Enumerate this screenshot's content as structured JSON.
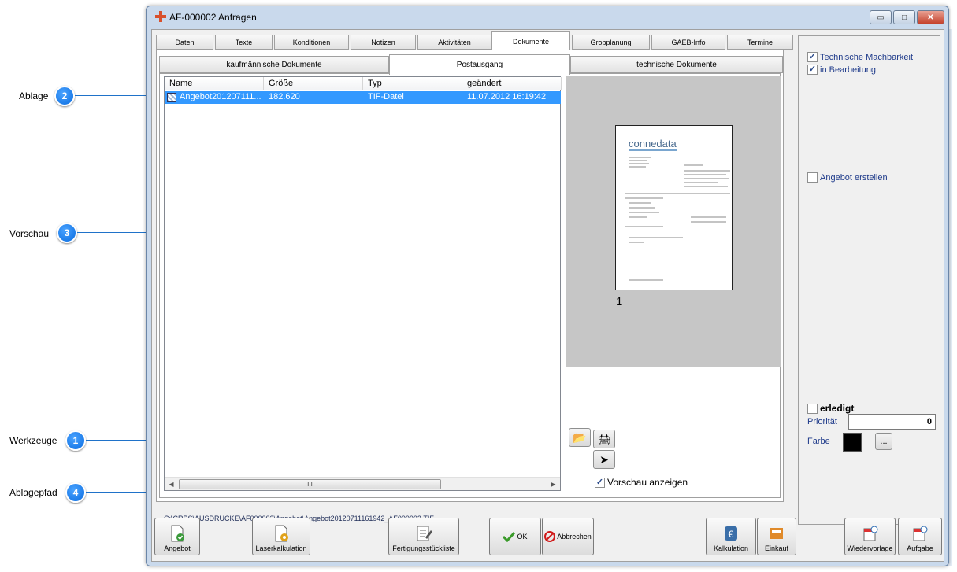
{
  "callouts": [
    {
      "label": "Ablage",
      "number": "2"
    },
    {
      "label": "Vorschau",
      "number": "3"
    },
    {
      "label": "Werkzeuge",
      "number": "1"
    },
    {
      "label": "Ablagepfad",
      "number": "4"
    }
  ],
  "window": {
    "title": "AF-000002 Anfragen",
    "minimize": "▭",
    "maximize": "□",
    "close": "✕"
  },
  "tabs": [
    "Daten",
    "Texte",
    "Konditionen",
    "Notizen",
    "Aktivitäten",
    "Dokumente",
    "Grobplanung",
    "GAEB-Info",
    "Termine"
  ],
  "active_tab": "Dokumente",
  "subtabs": [
    "kaufmännische Dokumente",
    "Postausgang",
    "technische Dokumente"
  ],
  "active_subtab": "Postausgang",
  "filelist": {
    "columns": [
      "Name",
      "Größe",
      "Typ",
      "geändert"
    ],
    "rows": [
      {
        "name": "Angebot201207111...",
        "size": "182.620",
        "type": "TIF-Datei",
        "changed": "11.07.2012 16:19:42"
      }
    ],
    "scroll_left": "◀",
    "scroll_right": "▶",
    "scroll_grip": "III"
  },
  "preview": {
    "page_number": "1",
    "thumb_logo": "connedata"
  },
  "tools": {
    "open": "📂",
    "print": "🖨",
    "send": "➤"
  },
  "show_preview": {
    "label": "Vorschau anzeigen",
    "checked": true
  },
  "path": "C:\\CRPS\\AUSDRUCKE\\AF000002\\Angebot\\Angebot20120711161942_AF000002.TIF",
  "right_panel": {
    "checks": [
      {
        "label": "Technische Machbarkeit",
        "checked": true
      },
      {
        "label": "in Bearbeitung",
        "checked": true
      },
      {
        "label": "Angebot erstellen",
        "checked": false
      }
    ],
    "erledigt": {
      "label": "erledigt",
      "checked": false
    },
    "prioritaet_label": "Priorität",
    "prioritaet_value": "0",
    "farbe_label": "Farbe",
    "farbe_color": "#000000",
    "dots": "..."
  },
  "bottom_buttons": {
    "angebot": "Angebot",
    "laserkalkulation": "Laserkalkulation",
    "fertigung": "Fertigungsstückliste",
    "ok": "OK",
    "abbrechen": "Abbrechen",
    "kalkulation": "Kalkulation",
    "einkauf": "Einkauf",
    "wiedervorlage": "Wiedervorlage",
    "aufgabe": "Aufgabe"
  },
  "colors": {
    "accent": "#3399ff",
    "callout_blue": "#1f72c9",
    "label_blue": "#1e3a8a"
  }
}
